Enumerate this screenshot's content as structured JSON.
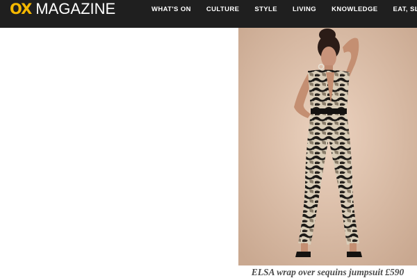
{
  "header": {
    "logo": {
      "brand": "OX",
      "name": "MAGAZINE"
    },
    "nav": [
      {
        "label": "WHAT'S ON"
      },
      {
        "label": "CULTURE"
      },
      {
        "label": "STYLE"
      },
      {
        "label": "LIVING"
      },
      {
        "label": "KNOWLEDGE"
      },
      {
        "label": "EAT, SLEEP, DRIN"
      }
    ]
  },
  "article": {
    "image_caption": "ELSA wrap over sequins jumpsuit £590"
  },
  "colors": {
    "header_bg": "#1f1f1f",
    "logo_accent": "#f5b800",
    "caption_text": "#4a4a4a"
  }
}
